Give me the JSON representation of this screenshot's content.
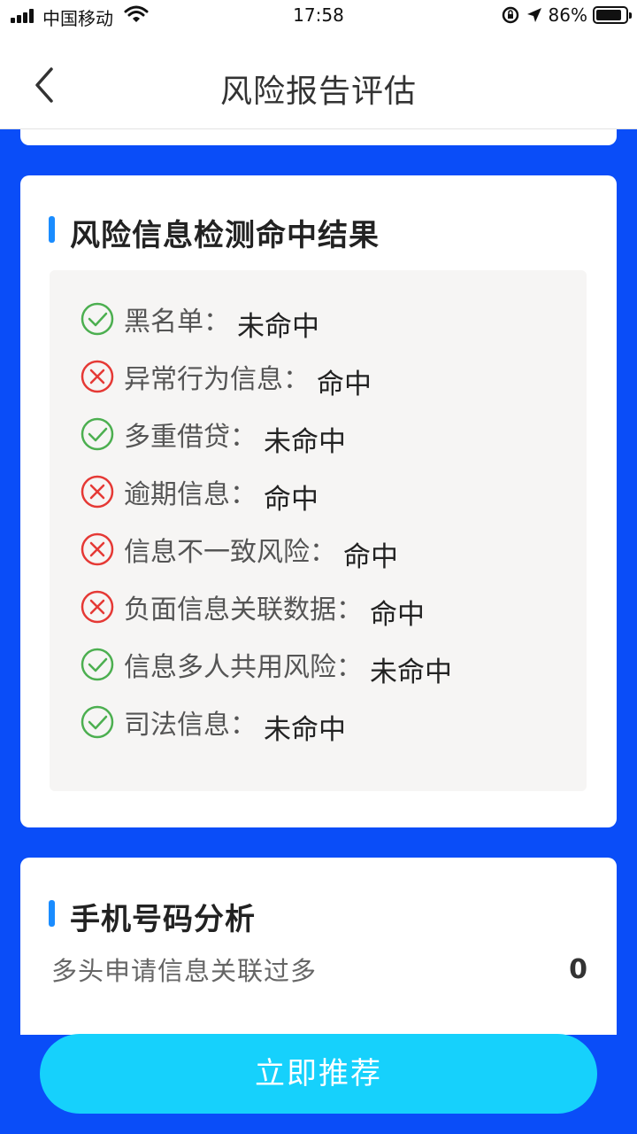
{
  "status_bar": {
    "carrier": "中国移动",
    "time": "17:58",
    "battery_text": "86%",
    "battery_level": 0.86,
    "icons": [
      "signal-icon",
      "wifi-icon",
      "rotation-lock-icon",
      "location-icon",
      "battery-icon"
    ]
  },
  "nav": {
    "title": "风险报告评估",
    "back_icon": "chevron-left-icon"
  },
  "risk_section": {
    "title": "风险信息检测命中结果",
    "items": [
      {
        "label": "黑名单：",
        "value": "未命中",
        "status": "pass"
      },
      {
        "label": "异常行为信息：",
        "value": "命中",
        "status": "hit"
      },
      {
        "label": "多重借贷：",
        "value": "未命中",
        "status": "pass"
      },
      {
        "label": "逾期信息：",
        "value": "命中",
        "status": "hit"
      },
      {
        "label": "信息不一致风险：",
        "value": "命中",
        "status": "hit"
      },
      {
        "label": "负面信息关联数据：",
        "value": "命中",
        "status": "hit"
      },
      {
        "label": "信息多人共用风险：",
        "value": "未命中",
        "status": "pass"
      },
      {
        "label": "司法信息：",
        "value": "未命中",
        "status": "pass"
      }
    ]
  },
  "phone_section": {
    "title": "手机号码分析",
    "rows": [
      {
        "label": "多头申请信息关联过多",
        "value": "0"
      }
    ]
  },
  "cta": {
    "label": "立即推荐"
  },
  "colors": {
    "page_background": "#0a4df8",
    "accent_bar": "#1a8cff",
    "pass": "#4caf50",
    "hit": "#e53935",
    "cta_background": "#16d1fc"
  }
}
